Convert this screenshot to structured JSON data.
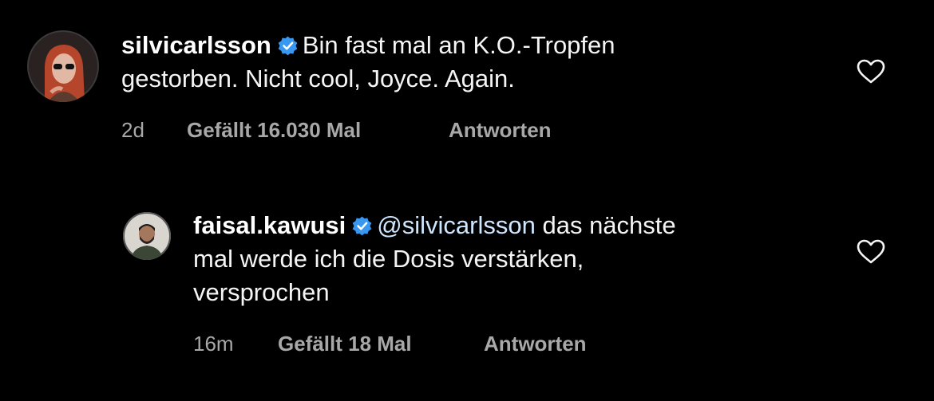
{
  "comments": [
    {
      "username": "silvicarlsson",
      "text_line1": "Bin fast mal an K.O.-Tropfen",
      "text_line2": "gestorben. Nicht cool, Joyce. Again.",
      "time": "2d",
      "likes": "Gefällt 16.030 Mal",
      "reply_label": "Antworten",
      "verified": true
    },
    {
      "username": "faisal.kawusi",
      "mention": "@silvicarlsson",
      "text_line1": " das nächste",
      "text_line2": "mal werde ich die Dosis verstärken,",
      "text_line3": "versprochen",
      "time": "16m",
      "likes": "Gefällt 18 Mal",
      "reply_label": "Antworten",
      "verified": true
    }
  ],
  "icons": {
    "verified": "verified-badge-icon",
    "like": "heart-outline-icon"
  },
  "colors": {
    "background": "#000000",
    "text": "#f5f5f5",
    "meta": "#a8a8a8",
    "verified": "#3897f0",
    "mention": "#cfe6ff"
  }
}
